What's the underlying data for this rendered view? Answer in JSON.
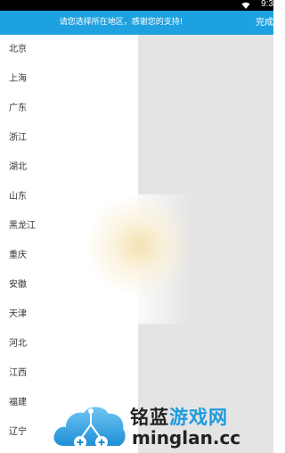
{
  "status_bar": {
    "time": "9:3",
    "wifi_icon": "wifi-icon"
  },
  "header": {
    "title": "请您选择所在地区，感谢您的支持!",
    "done_label": "完成",
    "background": "#1ea1e1"
  },
  "provinces": [
    "北京",
    "上海",
    "广东",
    "浙江",
    "湖北",
    "山东",
    "黑龙江",
    "重庆",
    "安徽",
    "天津",
    "河北",
    "江西",
    "福建",
    "辽宁"
  ],
  "watermark": {
    "brand_part1": "铭蓝",
    "brand_part2": "游戏网",
    "domain": "minglan.cc",
    "icon": "cloud-logo-icon"
  }
}
